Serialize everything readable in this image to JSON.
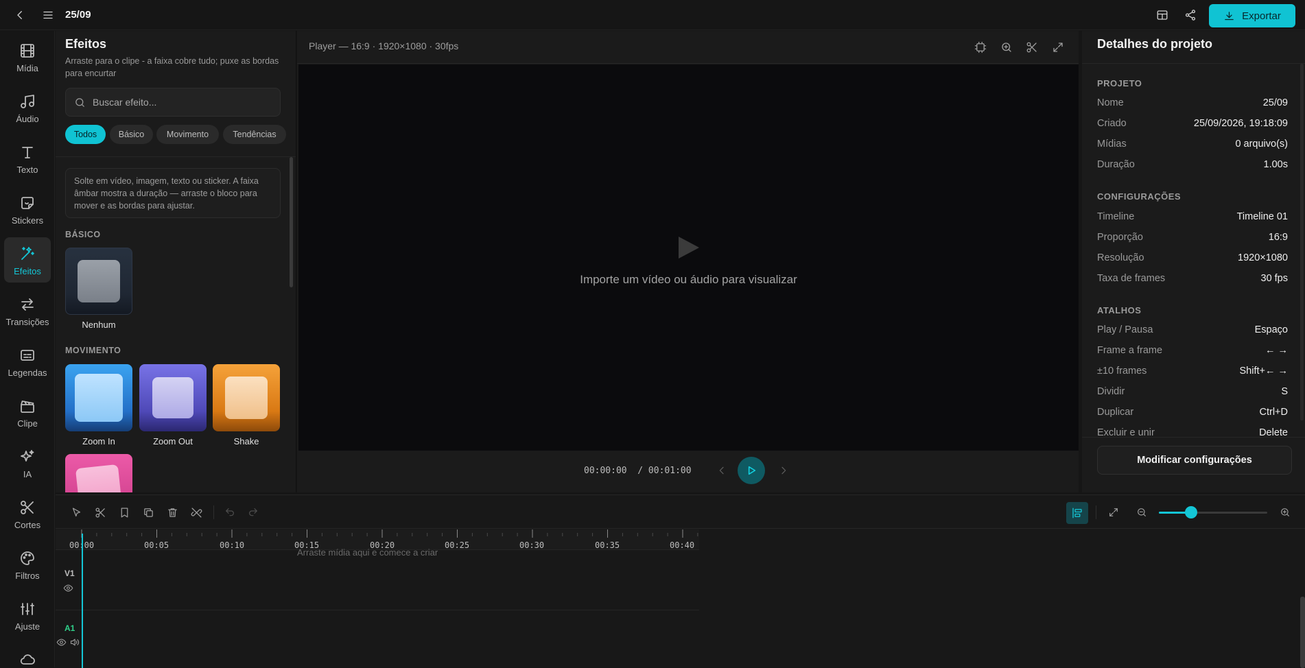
{
  "topbar": {
    "title": "25/09",
    "export_label": "Exportar"
  },
  "rail": {
    "items": [
      {
        "label": "Mídia"
      },
      {
        "label": "Áudio"
      },
      {
        "label": "Texto"
      },
      {
        "label": "Stickers"
      },
      {
        "label": "Efeitos"
      },
      {
        "label": "Transições"
      },
      {
        "label": "Legendas"
      },
      {
        "label": "Clipe"
      },
      {
        "label": "IA"
      },
      {
        "label": "Cortes"
      },
      {
        "label": "Filtros"
      },
      {
        "label": "Ajuste"
      }
    ],
    "active": "Efeitos"
  },
  "effects": {
    "title": "Efeitos",
    "subtitle": "Arraste para o clipe - a faixa cobre tudo; puxe as bordas para encurtar",
    "search_placeholder": "Buscar efeito...",
    "chips": [
      "Todos",
      "Básico",
      "Movimento",
      "Tendências"
    ],
    "hint": "Solte em vídeo, imagem, texto ou sticker. A faixa âmbar mostra a duração — arraste o bloco para mover e as bordas para ajustar.",
    "sections": [
      {
        "label": "BÁSICO",
        "items": [
          {
            "name": "Nenhum"
          }
        ]
      },
      {
        "label": "MOVIMENTO",
        "items": [
          {
            "name": "Zoom In"
          },
          {
            "name": "Zoom Out"
          },
          {
            "name": "Shake"
          }
        ]
      }
    ]
  },
  "player": {
    "info": "Player — 16:9 · 1920×1080 · 30fps",
    "empty_message": "Importe um vídeo ou áudio para visualizar",
    "current_time": "00:00:00",
    "total_time": "/ 00:01:00"
  },
  "details": {
    "title": "Detalhes do projeto",
    "sections": [
      {
        "label": "PROJETO",
        "rows": [
          {
            "k": "Nome",
            "v": "25/09"
          },
          {
            "k": "Criado",
            "v": "25/09/2026, 19:18:09"
          },
          {
            "k": "Mídias",
            "v": "0 arquivo(s)"
          },
          {
            "k": "Duração",
            "v": "1.00s"
          }
        ]
      },
      {
        "label": "CONFIGURAÇÕES",
        "rows": [
          {
            "k": "Timeline",
            "v": "Timeline 01"
          },
          {
            "k": "Proporção",
            "v": "16:9"
          },
          {
            "k": "Resolução",
            "v": "1920×1080"
          },
          {
            "k": "Taxa de frames",
            "v": "30 fps"
          }
        ]
      },
      {
        "label": "ATALHOS",
        "rows": [
          {
            "k": "Play / Pausa",
            "v": "Espaço"
          },
          {
            "k": "Frame a frame",
            "v": "← →"
          },
          {
            "k": "±10 frames",
            "v": "Shift+← →"
          },
          {
            "k": "Dividir",
            "v": "S"
          },
          {
            "k": "Duplicar",
            "v": "Ctrl+D"
          },
          {
            "k": "Excluir e unir",
            "v": "Delete"
          }
        ]
      }
    ],
    "modify_button": "Modificar configurações"
  },
  "timeline": {
    "ticks": [
      "00:00",
      "00:05",
      "00:10",
      "00:15",
      "00:20",
      "00:25",
      "00:30",
      "00:35",
      "00:40"
    ],
    "drop_hint": "Arraste mídia aqui e comece a criar",
    "tracks": [
      "V1",
      "A1"
    ],
    "zoom_level": 0.3,
    "track_colors": {
      "V1": "#bdbdbd",
      "A1": "#2fd08a"
    }
  }
}
